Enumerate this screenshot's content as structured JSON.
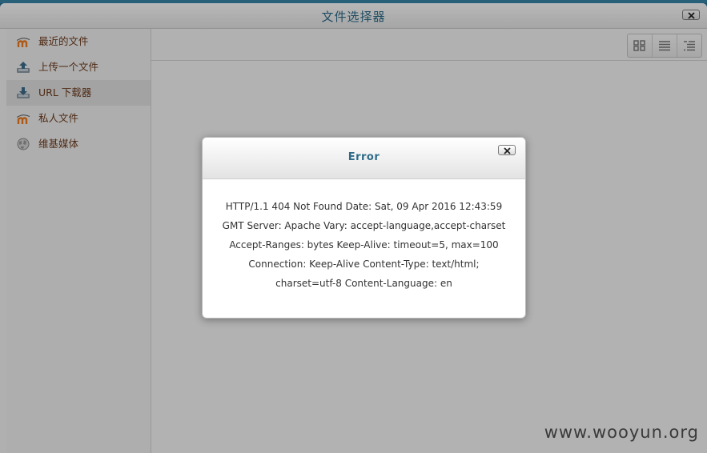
{
  "filepicker": {
    "title": "文件选择器",
    "sidebar": [
      {
        "label": "最近的文件",
        "icon": "moodle-icon",
        "active": false
      },
      {
        "label": "上传一个文件",
        "icon": "upload-icon",
        "active": false
      },
      {
        "label": "URL 下载器",
        "icon": "download-icon",
        "active": true
      },
      {
        "label": "私人文件",
        "icon": "moodle-icon",
        "active": false
      },
      {
        "label": "维基媒体",
        "icon": "wikimedia-globe-icon",
        "active": false
      }
    ],
    "view_buttons": [
      "icon-view-icon",
      "list-view-icon",
      "tree-view-icon"
    ]
  },
  "dialog": {
    "title": "Error",
    "lines": [
      "HTTP/1.1 404 Not Found Date: Sat, 09 Apr 2016 12:43:59",
      "GMT Server: Apache Vary: accept-language,accept-charset",
      "Accept-Ranges: bytes Keep-Alive: timeout=5, max=100",
      "Connection: Keep-Alive Content-Type: text/html;",
      "charset=utf-8 Content-Language: en"
    ]
  },
  "watermark": "www.wooyun.org",
  "colors": {
    "accent": "#2e6b8a",
    "sidebar_text": "#6d3b1e",
    "backdrop": "#2a6f8e"
  }
}
